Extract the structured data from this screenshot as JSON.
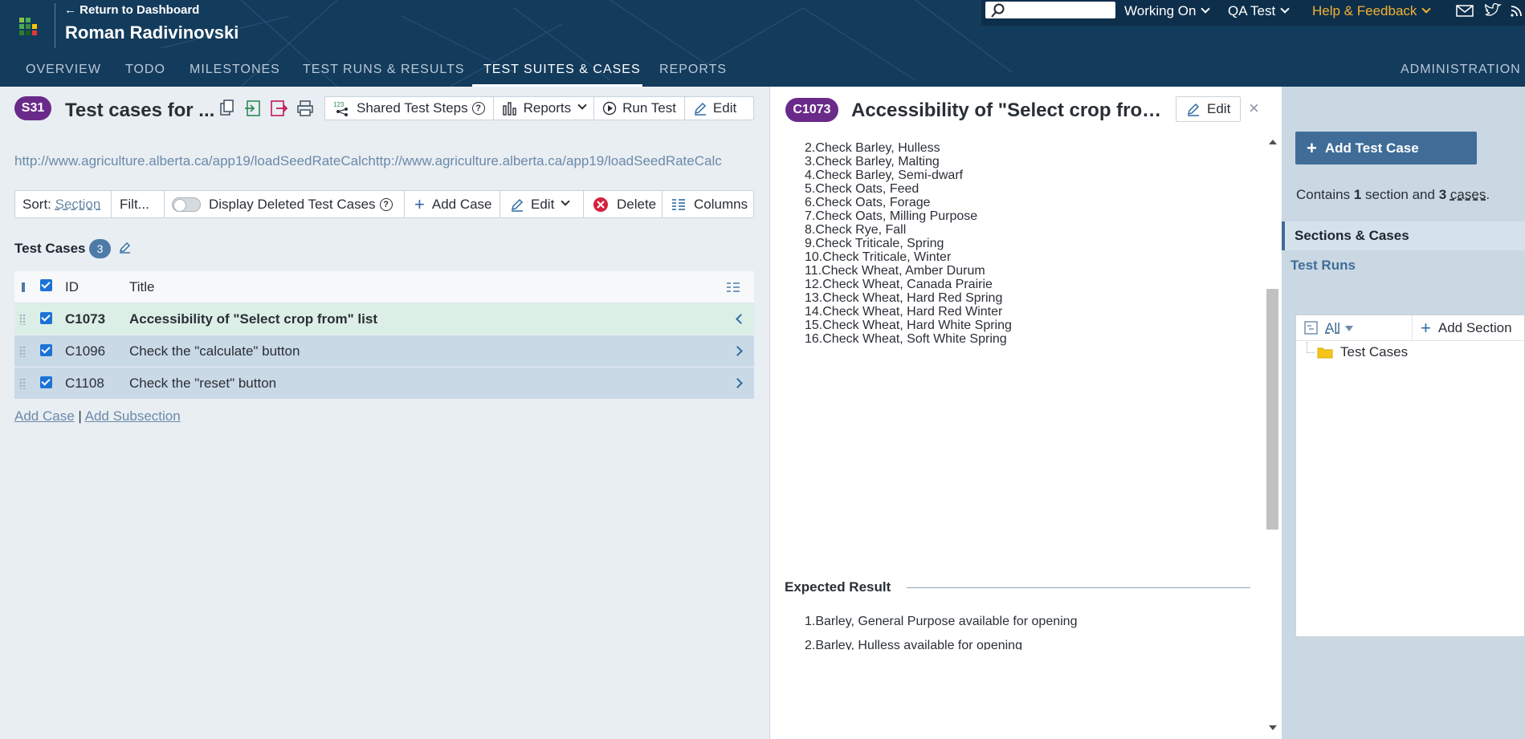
{
  "header": {
    "return_link": "← Return to Dashboard",
    "user_name": "Roman Radivinovski",
    "search_placeholder": "",
    "top_dropdowns": [
      "Working On",
      "QA Test",
      "Help & Feedback"
    ],
    "tabs": [
      {
        "label": "OVERVIEW",
        "active": false
      },
      {
        "label": "TODO",
        "active": false
      },
      {
        "label": "MILESTONES",
        "active": false
      },
      {
        "label": "TEST RUNS & RESULTS",
        "active": false
      },
      {
        "label": "TEST SUITES & CASES",
        "active": true
      },
      {
        "label": "REPORTS",
        "active": false
      }
    ],
    "admin": "ADMINISTRATION"
  },
  "suite": {
    "badge": "S31",
    "title": "Test cases for ...",
    "buttons": {
      "shared_steps": "Shared Test Steps",
      "reports": "Reports",
      "run_test": "Run Test",
      "edit": "Edit"
    },
    "url": "http://www.agriculture.alberta.ca/app19/loadSeedRateCalchttp://www.agriculture.alberta.ca/app19/loadSeedRateCalc"
  },
  "toolbar": {
    "sort_label": "Sort:",
    "sort_value": "Section",
    "filter": "Filt...",
    "display_deleted": "Display Deleted Test Cases",
    "add_case": "Add Case",
    "edit": "Edit",
    "delete": "Delete",
    "columns": "Columns"
  },
  "cases_section": {
    "title": "Test Cases",
    "count": "3",
    "columns": {
      "id": "ID",
      "title": "Title"
    },
    "rows": [
      {
        "id": "C1073",
        "title": "Accessibility of \"Select crop from\" list"
      },
      {
        "id": "C1096",
        "title": "Check the \"calculate\" button"
      },
      {
        "id": "C1108",
        "title": "Check the \"reset\" button"
      }
    ],
    "add_case": "Add Case",
    "separator": "|",
    "add_subsection": "Add Subsection"
  },
  "case_detail": {
    "badge": "C1073",
    "title": "Accessibility of \"Select crop from\" list",
    "edit": "Edit",
    "close": "×",
    "steps": [
      "2.Check Barley, Hulless",
      "3.Check Barley, Malting",
      "4.Check Barley, Semi-dwarf",
      "5.Check Oats, Feed",
      "6.Check Oats, Forage",
      "7.Check Oats, Milling Purpose",
      "8.Check Rye, Fall",
      "9.Check Triticale, Spring",
      "10.Check Triticale, Winter",
      "11.Check Wheat, Amber Durum",
      "12.Check Wheat, Canada Prairie",
      "13.Check Wheat, Hard Red Spring",
      "14.Check Wheat, Hard Red Winter",
      "15.Check Wheat, Hard White Spring",
      "16.Check Wheat, Soft White Spring"
    ],
    "expected_heading": "Expected Result",
    "expected": [
      "1.Barley, General Purpose available for opening",
      "2.Barley, Hulless available for opening"
    ]
  },
  "sidebar": {
    "add_test_case": "Add Test Case",
    "contains_pre": "Contains ",
    "sections_count": "1",
    "contains_mid": " section and ",
    "cases_count": "3",
    "contains_post": ".",
    "cases_word": "cases",
    "nav_sections": "Sections & Cases",
    "nav_runs": "Test Runs",
    "tree_all": "All",
    "add_section": "Add Section",
    "tree_node": "Test Cases"
  },
  "colors": {
    "header_bg": "#133b5c",
    "accent_purple": "#6a2a8a",
    "accent_blue": "#3f6d98",
    "help_orange": "#f2b233",
    "delete_red": "#d4213d"
  }
}
